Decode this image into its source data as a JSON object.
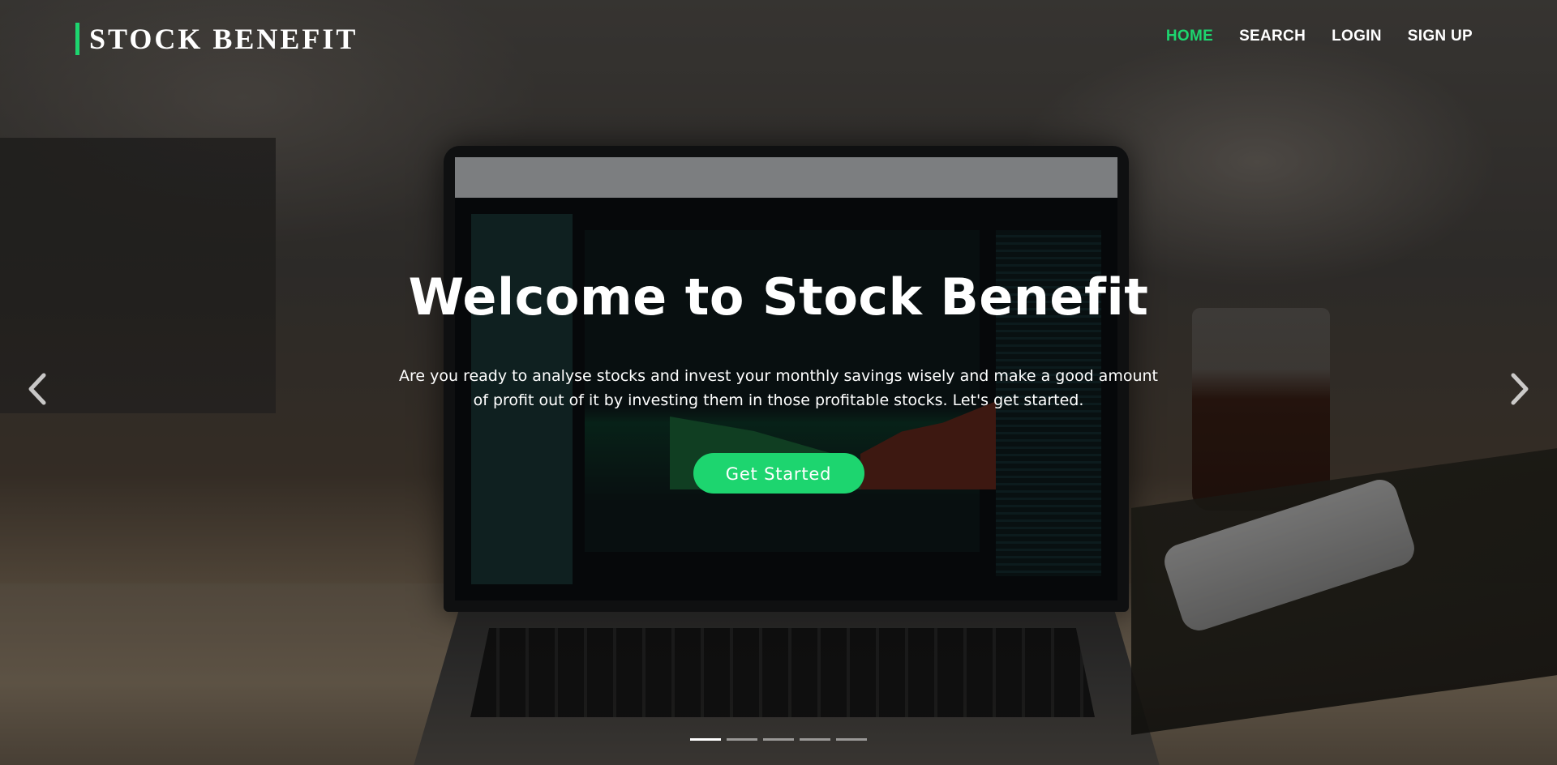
{
  "brand": {
    "name": "STOCK BENEFIT",
    "accent_color": "#1dd56f"
  },
  "nav": {
    "items": [
      {
        "label": "HOME",
        "active": true
      },
      {
        "label": "SEARCH",
        "active": false
      },
      {
        "label": "LOGIN",
        "active": false
      },
      {
        "label": "SIGN UP",
        "active": false
      }
    ]
  },
  "hero": {
    "title": "Welcome to Stock Benefit",
    "description": "Are you ready to analyse stocks and invest your monthly savings wisely and make a good amount of profit out of it by investing them in those profitable stocks. Let's get started.",
    "cta_label": "Get Started",
    "cta_color": "#1dd56f"
  },
  "carousel": {
    "prev_icon": "chevron-left-icon",
    "next_icon": "chevron-right-icon",
    "slide_count": 5,
    "active_slide": 1
  }
}
